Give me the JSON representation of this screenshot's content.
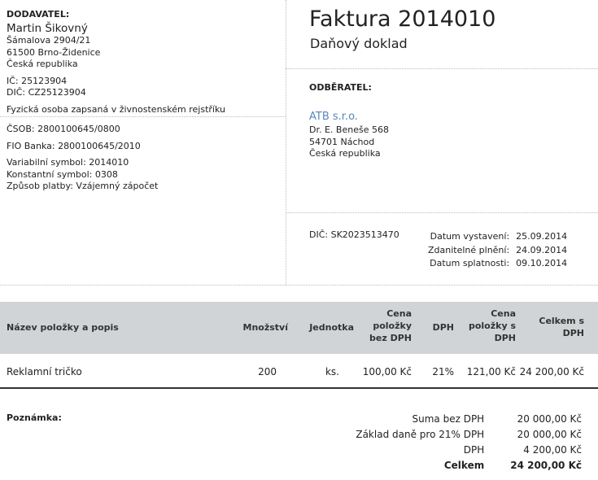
{
  "supplier": {
    "label": "DODAVATEL:",
    "name": "Martin Šikovný",
    "street": "Šámalova 2904/21",
    "city": "61500 Brno-Židenice",
    "country": "Česká republika",
    "ic": "IČ: 25123904",
    "dic": "DIČ: CZ25123904",
    "note": "Fyzická osoba zapsaná v živnostenském rejstříku"
  },
  "bank": {
    "csob": "ČSOB: 2800100645/0800",
    "fio": "FIO Banka: 2800100645/2010",
    "vs": "Variabilní symbol: 2014010",
    "ks": "Konstantní symbol: 0308",
    "payment": "Způsob platby: Vzájemný zápočet"
  },
  "invoice": {
    "title": "Faktura 2014010",
    "subtitle": "Daňový doklad"
  },
  "customer": {
    "label": "ODBĚRATEL:",
    "name": "ATB s.r.o.",
    "street": "Dr. E. Beneše 568",
    "city": "54701 Náchod",
    "country": "Česká republika",
    "dic": "DIČ: SK2023513470"
  },
  "dates": [
    {
      "label": "Datum vystavení:",
      "value": "25.09.2014"
    },
    {
      "label": "Zdanitelné plnění:",
      "value": "24.09.2014"
    },
    {
      "label": "Datum splatnosti:",
      "value": "09.10.2014"
    }
  ],
  "table": {
    "headers": {
      "name": "Název položky a popis",
      "qty": "Množství",
      "unit": "Jednotka",
      "price_l1": "Cena",
      "price_l2": "položky",
      "price_l3": "bez DPH",
      "vat": "DPH",
      "pricevat_l1": "Cena",
      "pricevat_l2": "položky s",
      "pricevat_l3": "DPH",
      "total_l1": "Celkem s",
      "total_l2": "DPH"
    },
    "rows": [
      {
        "name": "Reklamní tričko",
        "qty": "200",
        "unit": "ks.",
        "price": "100,00 Kč",
        "vat": "21%",
        "price_vat": "121,00 Kč",
        "total": "24 200,00 Kč"
      }
    ]
  },
  "note_label": "Poznámka:",
  "summary": [
    {
      "label": "Suma bez DPH",
      "value": "20 000,00 Kč"
    },
    {
      "label": "Základ daně pro 21% DPH",
      "value": "20 000,00 Kč"
    },
    {
      "label": "DPH",
      "value": "4 200,00 Kč"
    },
    {
      "label": "Celkem",
      "value": "24 200,00 Kč"
    }
  ]
}
